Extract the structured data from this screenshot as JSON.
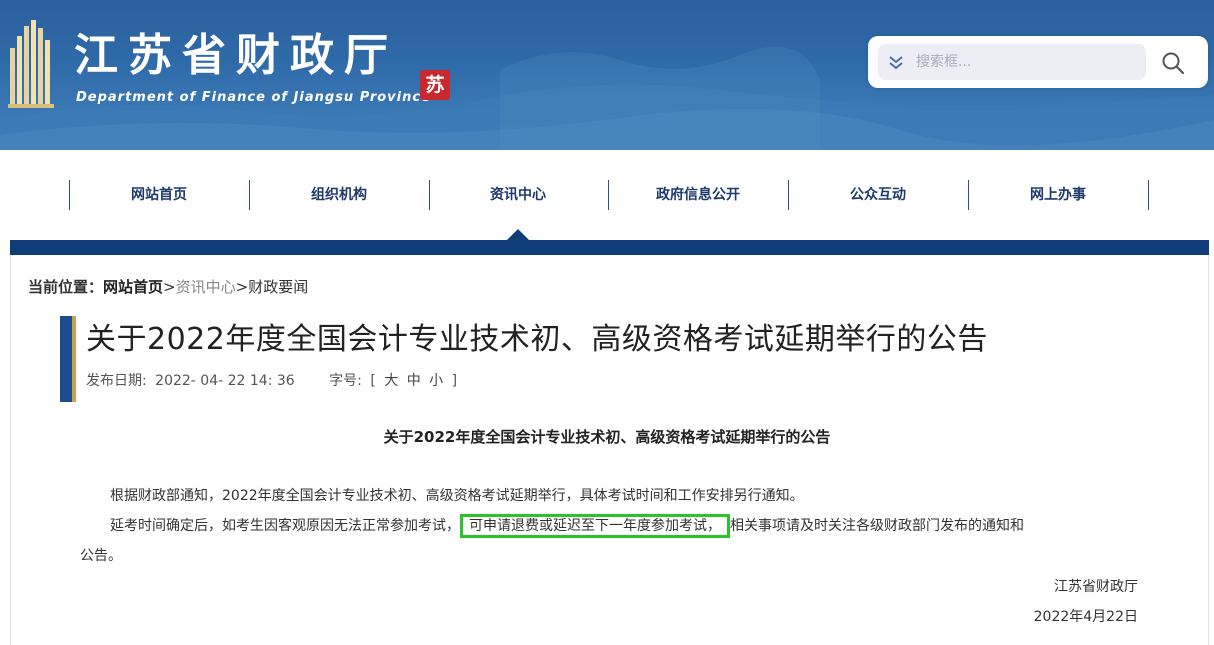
{
  "header": {
    "site_title": "江苏省财政厅",
    "site_subtitle": "Department of Finance of Jiangsu Province",
    "seal_char": "苏",
    "search": {
      "placeholder": "搜索框...",
      "toggle_icon": "chevron-double-down-icon",
      "search_icon": "magnifier-icon"
    },
    "colors": {
      "header_bg": "#2f6aa8",
      "nav_bar": "#0e3d7a",
      "seal": "#c8282e",
      "highlight": "#2dc22d"
    }
  },
  "nav": {
    "items": [
      {
        "label": "网站首页"
      },
      {
        "label": "组织机构"
      },
      {
        "label": "资讯中心"
      },
      {
        "label": "政府信息公开"
      },
      {
        "label": "公众互动"
      },
      {
        "label": "网上办事"
      }
    ],
    "active_index": 2
  },
  "breadcrumb": {
    "label": "当前位置：",
    "home": "网站首页",
    "sep": ">",
    "mid": "资讯中心",
    "current": "财政要闻"
  },
  "article": {
    "title": "关于2022年度全国会计专业技术初、高级资格考试延期举行的公告",
    "meta": {
      "date_label": "发布日期:",
      "date_value": "2022- 04- 22  14: 36",
      "font_label": "字号:",
      "bracket_open": "[",
      "font_large": "大",
      "font_medium": "中",
      "font_small": "小",
      "bracket_close": "]"
    },
    "doc_title": "关于2022年度全国会计专业技术初、高级资格考试延期举行的公告",
    "para1": "根据财政部通知，2022年度全国会计专业技术初、高级资格考试延期举行，具体考试时间和工作安排另行通知。",
    "para2_before": "延考时间确定后，如考生因客观原因无法正常参加考试，",
    "para2_highlight": "可申请退费或延迟至下一年度参加考试，",
    "para2_after": "相关事项请及时关注各级财政部门发布的通知和",
    "para3": "公告。",
    "sign_org": "江苏省财政厅",
    "sign_date": "2022年4月22日"
  }
}
